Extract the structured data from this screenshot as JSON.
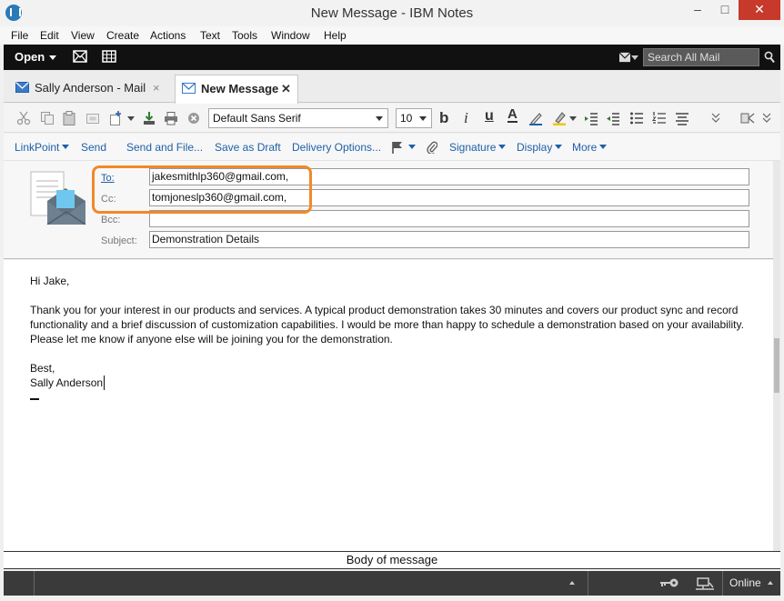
{
  "window": {
    "title": "New Message - IBM Notes",
    "minimize": "–",
    "maximize": "□",
    "close": "✕"
  },
  "menu": [
    "File",
    "Edit",
    "View",
    "Create",
    "Actions",
    "Text",
    "Tools",
    "Window",
    "Help"
  ],
  "topbar": {
    "open_label": "Open",
    "search_placeholder": "Search All Mail"
  },
  "tabs": [
    {
      "label": "Sally Anderson - Mail",
      "close": "×"
    },
    {
      "label": "New Message",
      "close": "✕"
    }
  ],
  "format": {
    "font_family": "Default Sans Serif",
    "font_size": "10",
    "bold": "b",
    "italic": "i",
    "underline": "u",
    "text_color": "A"
  },
  "actions": {
    "linkpoint": "LinkPoint",
    "send": "Send",
    "send_and_file": "Send and File...",
    "save_draft": "Save as Draft",
    "delivery_options": "Delivery Options...",
    "signature": "Signature",
    "display": "Display",
    "more": "More"
  },
  "header": {
    "to_label": "To:",
    "to_value": "jakesmithlp360@gmail.com,",
    "cc_label": "Cc:",
    "cc_value": "tomjoneslp360@gmail.com,",
    "bcc_label": "Bcc:",
    "bcc_value": "",
    "subject_label": "Subject:",
    "subject_value": "Demonstration Details"
  },
  "body": {
    "greeting": "Hi Jake,",
    "paragraph": "Thank you for your interest in our products and services. A typical product demonstration takes 30 minutes and covers our product sync and record functionality and a brief discussion of customization capabilities. I would be more than happy to schedule a demonstration based on your availability. Please let me know if anyone else will be joining you for the demonstration.",
    "closing": "Best,",
    "signature": "Sally Anderson"
  },
  "body_label": "Body of message",
  "status": {
    "online": "Online"
  },
  "colors": {
    "accent_link": "#1f5fa8",
    "highlight": "#f0892a",
    "close_button": "#c7392b"
  }
}
